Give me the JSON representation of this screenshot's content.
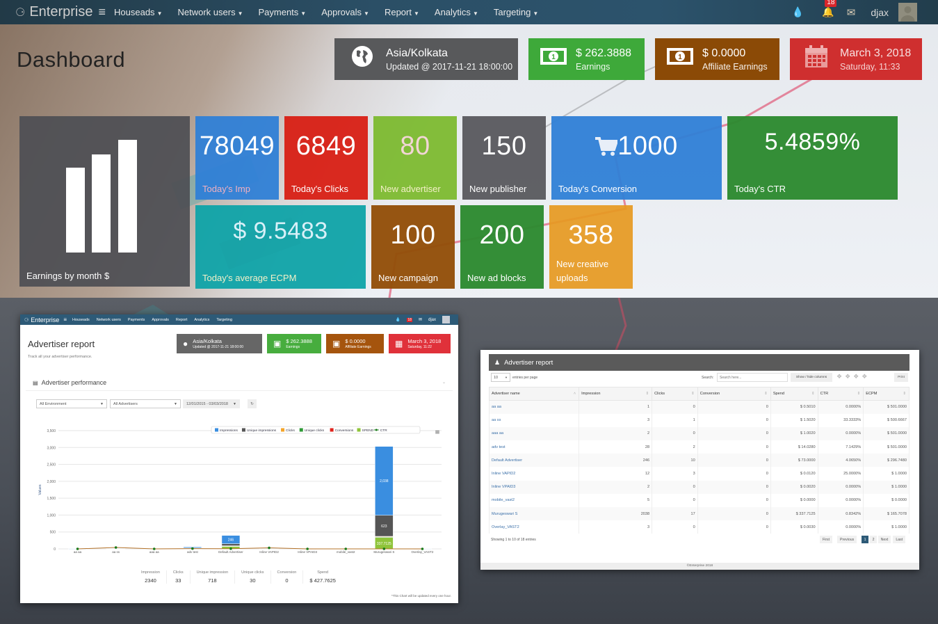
{
  "navbar": {
    "brand": "Enterprise",
    "menu_icon": "hamburger-icon",
    "items": [
      {
        "label": "Houseads"
      },
      {
        "label": "Network users"
      },
      {
        "label": "Payments"
      },
      {
        "label": "Approvals"
      },
      {
        "label": "Report"
      },
      {
        "label": "Analytics"
      },
      {
        "label": "Targeting"
      }
    ],
    "notification_count": "18",
    "username": "djax"
  },
  "header": {
    "title": "Dashboard",
    "timezone": {
      "title": "Asia/Kolkata",
      "subtitle": "Updated @ 2017-11-21 18:00:00",
      "icon": "globe-icon",
      "color": "#58595b"
    },
    "earnings": {
      "title": "$ 262.3888",
      "subtitle": "Earnings",
      "icon": "money-icon",
      "color": "#3ea93a"
    },
    "affiliate": {
      "title": "$ 0.0000",
      "subtitle": "Affiliate Earnings",
      "icon": "money-icon",
      "color": "#8b4a06"
    },
    "date": {
      "title": "March 3, 2018",
      "subtitle": "Saturday, 11:33",
      "icon": "calendar-icon",
      "color": "#cf2f2f"
    }
  },
  "tiles": {
    "earnings_month": {
      "label": "Earnings by month $",
      "color": "#55565a"
    },
    "imp": {
      "value": "78049",
      "label": "Today's Imp",
      "color": "#2f7fd6"
    },
    "clicks": {
      "value": "6849",
      "label": "Today's Clicks",
      "color": "#d81f14"
    },
    "advertiser": {
      "value": "80",
      "label": "New advertiser",
      "color": "#79b82a"
    },
    "publisher": {
      "value": "150",
      "label": "New publisher",
      "color": "#58595d"
    },
    "conversion": {
      "value": "1000",
      "label": "Today's Conversion",
      "color": "#2f7fd6"
    },
    "ctr": {
      "value": "5.4859%",
      "label": "Today's CTR",
      "color": "#2d8a31"
    },
    "ecpm": {
      "value": "$ 9.5483",
      "label": "Today's average ECPM",
      "color": "#0fa3a8"
    },
    "campaign": {
      "value": "100",
      "label": "New campaign",
      "color": "#93500a"
    },
    "adblocks": {
      "value": "200",
      "label": "New ad blocks",
      "color": "#2d8a31"
    },
    "creative": {
      "value": "358",
      "label_line1": "New creative",
      "label_line2": "uploads",
      "color": "#e69a21"
    }
  },
  "report_preview": {
    "navbar": {
      "brand": "Enterprise",
      "items": [
        "Houseads",
        "Network users",
        "Payments",
        "Approvals",
        "Report",
        "Analytics",
        "Targeting"
      ],
      "notification_count": "18",
      "username": "djax"
    },
    "title": "Advertiser report",
    "subtitle": "Track all your advertiser performance.",
    "boxes": {
      "timezone": {
        "title": "Asia/Kolkata",
        "subtitle": "Updated @ 2017-11-21 18:00:00"
      },
      "earnings": {
        "title": "$ 262.3888",
        "subtitle": "Earnings"
      },
      "affiliate": {
        "title": "$ 0.0000",
        "subtitle": "Affiliate Earnings"
      },
      "date": {
        "title": "March 3, 2018",
        "subtitle": "Saturday, 11:22"
      }
    },
    "panel_title": "Advertiser performance",
    "filters": {
      "environment": "All Environment",
      "advertisers": "All Advertisers",
      "date_range": "12/01/2015 - 03/03/2018"
    },
    "summary": [
      {
        "label": "Impression",
        "value": "2340"
      },
      {
        "label": "Clicks",
        "value": "33"
      },
      {
        "label": "Unique impression",
        "value": "718"
      },
      {
        "label": "Unique clicks",
        "value": "30"
      },
      {
        "label": "Conversion",
        "value": "0"
      },
      {
        "label": "Spend",
        "value": "$ 427.7625"
      }
    ],
    "footnote": "*This Chart will be updated every one hour."
  },
  "chart_data": {
    "type": "bar",
    "stacked": true,
    "ylabel": "Values",
    "xlabel": "",
    "ylim": [
      0,
      3500
    ],
    "yticks": [
      "0",
      "500",
      "1,000",
      "1,500",
      "2,000",
      "2,500",
      "3,000",
      "3,500"
    ],
    "ytick_values": [
      0,
      500,
      1000,
      1500,
      2000,
      2500,
      3000,
      3500
    ],
    "grid": true,
    "legend_position": "top-right",
    "categories": [
      "aa aa",
      "aa ss",
      "aaa aa",
      "adv test",
      "Default Advertiser",
      "Inline VAPID2",
      "Inline VPAID3",
      "mobile_vast2",
      "Murugeswari S",
      "Overlay_VAST2"
    ],
    "series": [
      {
        "name": "Impressions",
        "color": "#3a8ee0",
        "values": [
          1,
          3,
          2,
          28,
          246,
          12,
          2,
          5,
          2038,
          3
        ]
      },
      {
        "name": "Unique impressions",
        "color": "#555555",
        "values": [
          1,
          1,
          1,
          10,
          60,
          5,
          1,
          2,
          623,
          1
        ]
      },
      {
        "name": "Clicks",
        "color": "#f4a429",
        "values": [
          0,
          1,
          0,
          2,
          10,
          3,
          0,
          0,
          17,
          0
        ]
      },
      {
        "name": "Unique clicks",
        "color": "#2e9a36",
        "values": [
          0,
          1,
          0,
          2,
          9,
          2,
          0,
          0,
          16,
          0
        ]
      },
      {
        "name": "Conversions",
        "color": "#e0231c",
        "values": [
          0,
          0,
          0,
          0,
          0,
          0,
          0,
          0,
          0,
          0
        ]
      },
      {
        "name": "SPEND",
        "color": "#8fc43a",
        "values": [
          0.501,
          1.502,
          1.002,
          14.028,
          73.0,
          0.012,
          0.002,
          0.0,
          337.7125,
          0.003
        ]
      },
      {
        "name": "CTR",
        "type": "line",
        "color": "#1b7a1b",
        "values": [
          0.0,
          33.3333,
          0.0,
          7.1429,
          4.065,
          25.0,
          0.0,
          0.0,
          0.8342,
          0.0
        ]
      }
    ],
    "data_labels": [
      {
        "category": "Default Advertiser",
        "text": "246"
      },
      {
        "category": "Murugeswari S",
        "text": "2,038"
      },
      {
        "category": "Murugeswari S",
        "text": "623"
      },
      {
        "category": "Murugeswari S",
        "text": "337.7125"
      }
    ]
  },
  "table": {
    "title": "Advertiser report",
    "page_size": "10",
    "page_size_label": "entries per page",
    "search_label": "Search:",
    "search_placeholder": "Search here...",
    "show_hide_label": "Show / hide columns",
    "print_label": "Print",
    "columns": [
      "Advertiser name",
      "Impression",
      "Clicks",
      "Conversion",
      "Spend",
      "CTR",
      "ECPM"
    ],
    "rows": [
      [
        "aa aa",
        "1",
        "0",
        "0",
        "$ 0.5010",
        "0.0000%",
        "$ 501.0000"
      ],
      [
        "aa ss",
        "3",
        "1",
        "0",
        "$ 1.5020",
        "33.3333%",
        "$ 500.6667"
      ],
      [
        "aaa aa",
        "2",
        "0",
        "0",
        "$ 1.0020",
        "0.0000%",
        "$ 501.0000"
      ],
      [
        "adv test",
        "28",
        "2",
        "0",
        "$ 14.0280",
        "7.1429%",
        "$ 501.0000"
      ],
      [
        "Default Advertiser",
        "246",
        "10",
        "0",
        "$ 73.0000",
        "4.0650%",
        "$ 296.7480"
      ],
      [
        "Inline VAPID2",
        "12",
        "3",
        "0",
        "$ 0.0120",
        "25.0000%",
        "$ 1.0000"
      ],
      [
        "Inline VPAID3",
        "2",
        "0",
        "0",
        "$ 0.0020",
        "0.0000%",
        "$ 1.0000"
      ],
      [
        "mobile_vast2",
        "5",
        "0",
        "0",
        "$ 0.0000",
        "0.0000%",
        "$ 0.0000"
      ],
      [
        "Murugeswari S",
        "2038",
        "17",
        "0",
        "$ 337.7125",
        "0.8342%",
        "$ 165.7078"
      ],
      [
        "Overlay_VAST2",
        "3",
        "0",
        "0",
        "$ 0.0030",
        "0.0000%",
        "$ 1.0000"
      ]
    ],
    "info": "Showing 1 to 10 of 18 entries",
    "pagination": [
      "First",
      "Previous",
      "1",
      "2",
      "Next",
      "Last"
    ],
    "active_page": "1",
    "footer": "©Enterprise 2018"
  }
}
